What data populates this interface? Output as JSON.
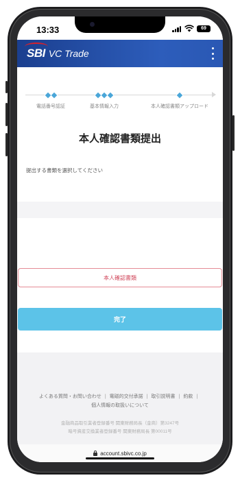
{
  "status_bar": {
    "time": "13:33",
    "battery": "69"
  },
  "app": {
    "brand_sbi": "SBI",
    "brand_name": "VC Trade"
  },
  "steps": [
    {
      "label": "電話番号認証",
      "diamonds": 2
    },
    {
      "label": "基本情報入力",
      "diamonds": 3
    },
    {
      "label": "本人確認書類アップロード",
      "diamonds": 1
    }
  ],
  "page": {
    "title": "本人確認書類提出",
    "instruction": "提出する書類を選択してください",
    "document_button": "本人確認書類",
    "done_button": "完了"
  },
  "footer": {
    "links": [
      "よくある質問・お問い合わせ",
      "電磁的交付承諾",
      "取引説明書",
      "約款",
      "個人情報の取扱いについて"
    ],
    "legal_1": "金融商品取引業者登録番号 関東財務局長（金商）第3247号",
    "legal_2": "暗号資産交換業者登録番号 関東財務局長 第00011号"
  },
  "browser": {
    "url": "account.sbivc.co.jp"
  },
  "colors": {
    "brand_blue": "#1b3f8f",
    "accent_red": "#d8202b",
    "step_diamond": "#4aa6d8",
    "done_button": "#5cc3e8"
  }
}
